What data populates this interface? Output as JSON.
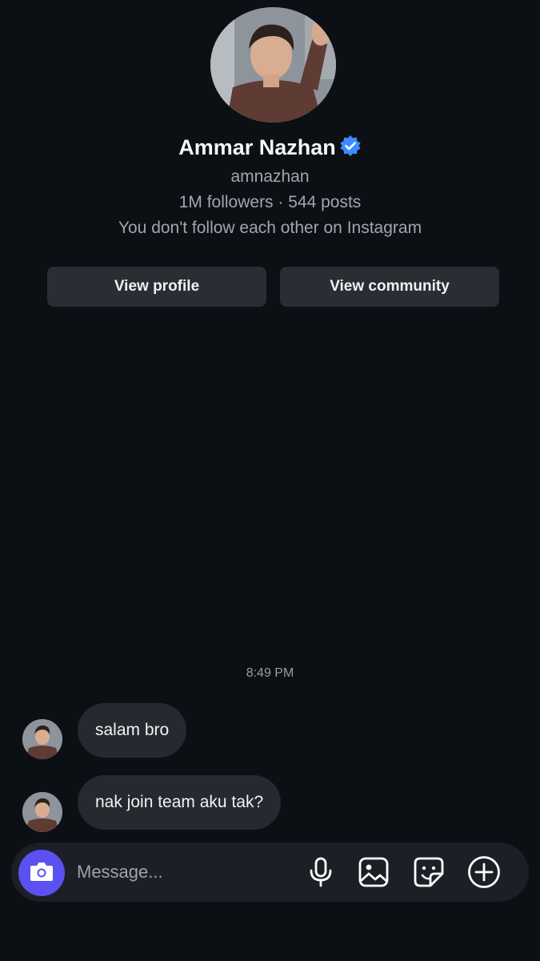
{
  "profile": {
    "name": "Ammar Nazhan",
    "verified_icon": "verified-badge-icon",
    "handle": "amnazhan",
    "stats": "1M followers · 544 posts",
    "relation": "You don't follow each other on Instagram"
  },
  "actions": {
    "view_profile": "View profile",
    "view_community": "View community"
  },
  "chat": {
    "timestamp": "8:49 PM",
    "messages": [
      {
        "text": "salam bro"
      },
      {
        "text": "nak join team aku tak?"
      }
    ]
  },
  "composer": {
    "placeholder": "Message...",
    "icons": [
      "camera-icon",
      "microphone-icon",
      "gallery-icon",
      "sticker-icon",
      "add-icon"
    ]
  },
  "colors": {
    "background": "#0c0f14",
    "accent": "#5b50f0",
    "verified": "#3d8bff",
    "bubble": "#26292f"
  }
}
